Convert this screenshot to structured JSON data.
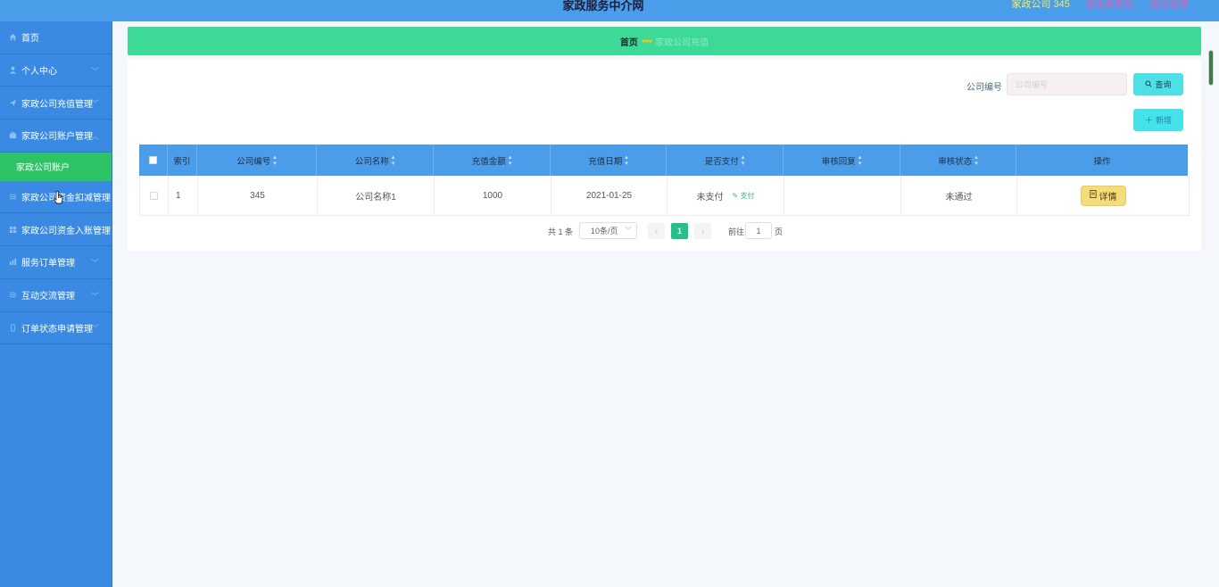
{
  "header": {
    "title": "家政服务中介网",
    "user_label": "家政公司 345",
    "back_link": "退出到前台",
    "logout_link": "退出登录"
  },
  "sidebar": {
    "items": [
      {
        "label": "首页",
        "icon": "home-icon"
      },
      {
        "label": "个人中心",
        "icon": "user-icon"
      },
      {
        "label": "家政公司充值管理",
        "icon": "send-icon"
      },
      {
        "label": "家政公司账户管理",
        "icon": "briefcase-icon"
      },
      {
        "label": "家政公司资金扣减管理",
        "icon": "list-icon"
      },
      {
        "label": "家政公司资金入账管理",
        "icon": "grid-icon"
      },
      {
        "label": "服务订单管理",
        "icon": "chart-icon"
      },
      {
        "label": "互动交流管理",
        "icon": "list-icon"
      },
      {
        "label": "订单状态申请管理",
        "icon": "phone-icon"
      }
    ],
    "sub_item": "家政公司账户"
  },
  "breadcrumb": {
    "home": "首页",
    "current": "家政公司充值"
  },
  "search": {
    "label": "公司编号",
    "placeholder": "公司编号",
    "query_button": "查询"
  },
  "add_button": "新增",
  "table": {
    "headers": [
      "",
      "索引",
      "公司编号",
      "公司名称",
      "充值金额",
      "充值日期",
      "是否支付",
      "审核回复",
      "审核状态",
      "操作"
    ],
    "rows": [
      {
        "index": "1",
        "company_no": "345",
        "company_name": "公司名称1",
        "amount": "1000",
        "date": "2021-01-25",
        "paid": "未支付",
        "pay_action": "支付",
        "reply": "",
        "status": "未通过",
        "detail_button": "详情"
      }
    ]
  },
  "pagination": {
    "total": "共 1 条",
    "page_size": "10条/页",
    "current_page": "1",
    "goto_label": "前往",
    "goto_value": "1",
    "page_suffix": "页"
  }
}
